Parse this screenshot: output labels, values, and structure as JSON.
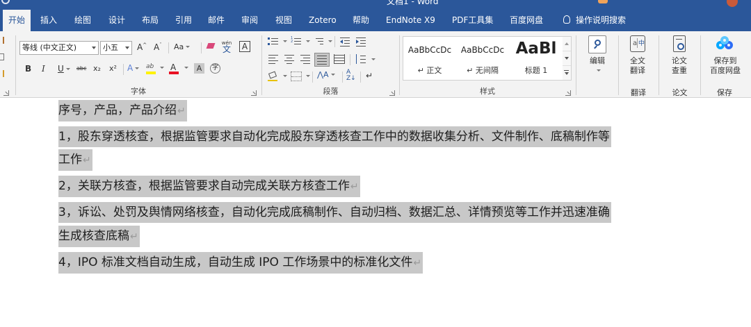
{
  "window": {
    "title": "文档1 - Word"
  },
  "tabs": [
    "开始",
    "插入",
    "绘图",
    "设计",
    "布局",
    "引用",
    "邮件",
    "审阅",
    "视图",
    "Zotero",
    "帮助",
    "EndNote X9",
    "PDF工具集",
    "百度网盘"
  ],
  "tell_me": "操作说明搜索",
  "font_group": {
    "font_name": "等线 (中文正文)",
    "font_size": "小五",
    "grow_font": "A",
    "shrink_font": "A",
    "change_case": "Aa",
    "bold": "B",
    "italic": "I",
    "underline": "U",
    "strikethrough": "abc",
    "subscript": "x₂",
    "superscript": "x²",
    "phonetic": "wén",
    "font_color": "A",
    "char_shading": "A",
    "label": "字体"
  },
  "paragraph_group": {
    "label": "段落"
  },
  "styles_group": {
    "items": [
      {
        "sample": "AaBbCcDc",
        "name": "↵ 正文"
      },
      {
        "sample": "AaBbCcDc",
        "name": "↵ 无间隔"
      },
      {
        "sample": "AaBl",
        "name": "标题 1"
      }
    ],
    "label": "样式"
  },
  "editing": {
    "label": "编辑"
  },
  "translate": {
    "label": "全文\n翻译",
    "group_label": "翻译"
  },
  "paper_check": {
    "label": "论文\n查重",
    "group_label": "论文"
  },
  "save_baidu": {
    "label": "保存到\n百度网盘",
    "group_label": "保存"
  },
  "document": {
    "lines": [
      "序号，产品，产品介绍",
      "1，股东穿透核查，根据监管要求自动化完成股东穿透核查工作中的数据收集分析、文件制作、底稿制作等",
      "工作",
      "2，关联方核查，根据监管要求自动完成关联方核查工作",
      "3，诉讼、处罚及舆情网络核查，自动化完成底稿制作、自动归档、数据汇总、详情预览等工作并迅速准确",
      "生成核查底稿",
      "4，IPO 标准文档自动生成，自动生成 IPO 工作场景中的标准化文件"
    ]
  },
  "colors": {
    "accent": "#2b579a",
    "ribbon_bg": "#f3f3f3",
    "selection": "#c8c8c8"
  }
}
